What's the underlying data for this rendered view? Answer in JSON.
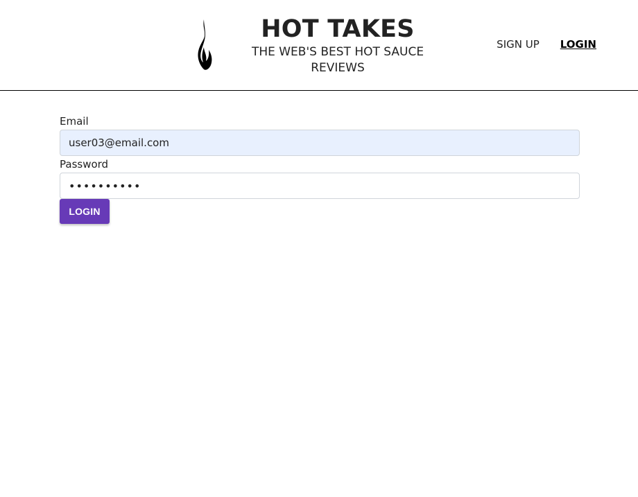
{
  "header": {
    "title": "HOT TAKES",
    "subtitle_line1": "THE WEB'S BEST HOT SAUCE",
    "subtitle_line2": "REVIEWS",
    "logo_icon": "flame-icon"
  },
  "nav": {
    "signup_label": "SIGN UP",
    "login_label": "LOGIN"
  },
  "form": {
    "email_label": "Email",
    "email_value": "user03@email.com",
    "password_label": "Password",
    "password_value": "••••••••••",
    "submit_label": "LOGIN"
  },
  "colors": {
    "accent": "#673ab7",
    "autofill_bg": "#e8f0fe"
  }
}
